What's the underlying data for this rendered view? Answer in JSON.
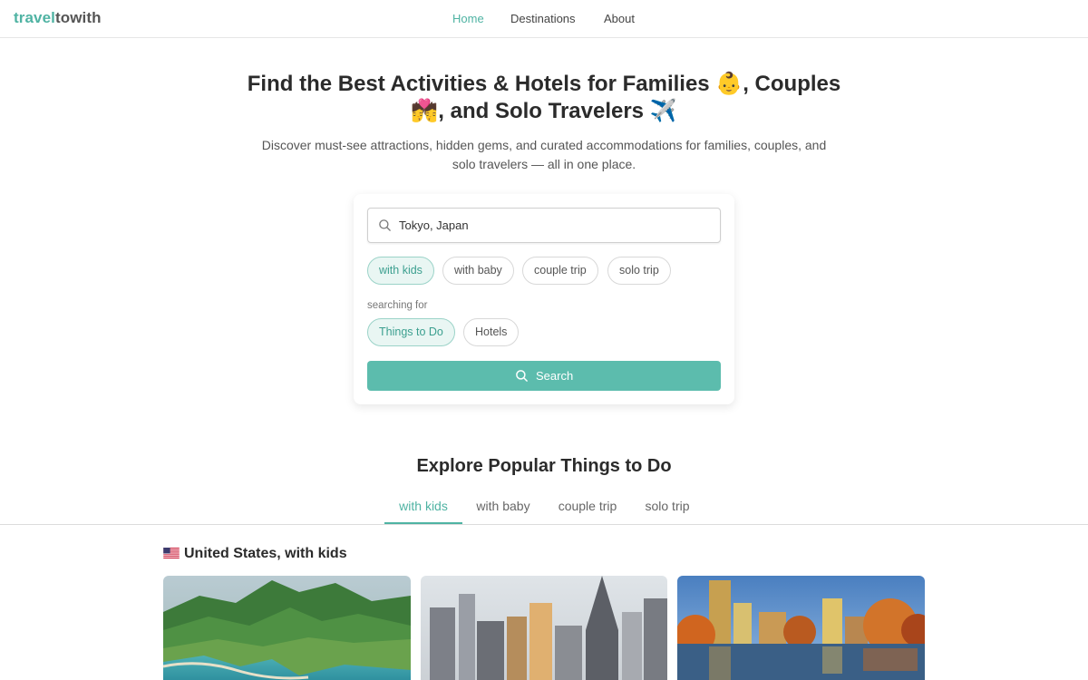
{
  "brand": {
    "part1": "travel",
    "part2": "towith"
  },
  "nav": {
    "items": [
      "Home",
      "Destinations",
      "About"
    ],
    "active": "Home"
  },
  "hero": {
    "title_line1": "Find the Best Activities & Hotels for Families 👶, Couples",
    "title_line2": "💏, and Solo Travelers ✈️",
    "subtitle": "Discover must-see attractions, hidden gems, and curated accommodations for families, couples, and solo travelers — all in one place."
  },
  "search": {
    "value": "Tokyo, Japan",
    "companions": [
      "with kids",
      "with baby",
      "couple trip",
      "solo trip"
    ],
    "companion_selected": "with kids",
    "searching_for_label": "searching for",
    "types": [
      "Things to Do",
      "Hotels"
    ],
    "type_selected": "Things to Do",
    "button_label": "Search"
  },
  "explore": {
    "title": "Explore Popular Things to Do",
    "tabs": [
      "with kids",
      "with baby",
      "couple trip",
      "solo trip"
    ],
    "active_tab": "with kids"
  },
  "section": {
    "title": "United States, with kids",
    "flag_icon": "us-flag-icon"
  },
  "photos": [
    {
      "subject": "green coastal mountains and turquoise sea"
    },
    {
      "subject": "city skyscrapers skyline"
    },
    {
      "subject": "city skyline reflected on lake with autumn trees"
    }
  ],
  "colors": {
    "accent": "#4fb3a3",
    "button": "#5cbcad",
    "chip_selected_bg": "#e9f6f3"
  }
}
